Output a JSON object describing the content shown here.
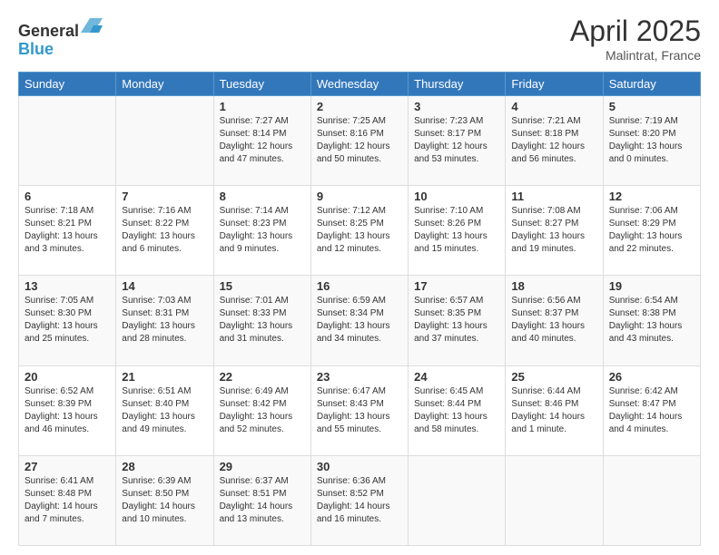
{
  "header": {
    "logo": {
      "line1": "General",
      "line2": "Blue"
    },
    "title": "April 2025",
    "location": "Malintrat, France"
  },
  "days_of_week": [
    "Sunday",
    "Monday",
    "Tuesday",
    "Wednesday",
    "Thursday",
    "Friday",
    "Saturday"
  ],
  "weeks": [
    [
      null,
      null,
      {
        "day": 1,
        "sunrise": "7:27 AM",
        "sunset": "8:14 PM",
        "daylight": "12 hours and 47 minutes."
      },
      {
        "day": 2,
        "sunrise": "7:25 AM",
        "sunset": "8:16 PM",
        "daylight": "12 hours and 50 minutes."
      },
      {
        "day": 3,
        "sunrise": "7:23 AM",
        "sunset": "8:17 PM",
        "daylight": "12 hours and 53 minutes."
      },
      {
        "day": 4,
        "sunrise": "7:21 AM",
        "sunset": "8:18 PM",
        "daylight": "12 hours and 56 minutes."
      },
      {
        "day": 5,
        "sunrise": "7:19 AM",
        "sunset": "8:20 PM",
        "daylight": "13 hours and 0 minutes."
      }
    ],
    [
      {
        "day": 6,
        "sunrise": "7:18 AM",
        "sunset": "8:21 PM",
        "daylight": "13 hours and 3 minutes."
      },
      {
        "day": 7,
        "sunrise": "7:16 AM",
        "sunset": "8:22 PM",
        "daylight": "13 hours and 6 minutes."
      },
      {
        "day": 8,
        "sunrise": "7:14 AM",
        "sunset": "8:23 PM",
        "daylight": "13 hours and 9 minutes."
      },
      {
        "day": 9,
        "sunrise": "7:12 AM",
        "sunset": "8:25 PM",
        "daylight": "13 hours and 12 minutes."
      },
      {
        "day": 10,
        "sunrise": "7:10 AM",
        "sunset": "8:26 PM",
        "daylight": "13 hours and 15 minutes."
      },
      {
        "day": 11,
        "sunrise": "7:08 AM",
        "sunset": "8:27 PM",
        "daylight": "13 hours and 19 minutes."
      },
      {
        "day": 12,
        "sunrise": "7:06 AM",
        "sunset": "8:29 PM",
        "daylight": "13 hours and 22 minutes."
      }
    ],
    [
      {
        "day": 13,
        "sunrise": "7:05 AM",
        "sunset": "8:30 PM",
        "daylight": "13 hours and 25 minutes."
      },
      {
        "day": 14,
        "sunrise": "7:03 AM",
        "sunset": "8:31 PM",
        "daylight": "13 hours and 28 minutes."
      },
      {
        "day": 15,
        "sunrise": "7:01 AM",
        "sunset": "8:33 PM",
        "daylight": "13 hours and 31 minutes."
      },
      {
        "day": 16,
        "sunrise": "6:59 AM",
        "sunset": "8:34 PM",
        "daylight": "13 hours and 34 minutes."
      },
      {
        "day": 17,
        "sunrise": "6:57 AM",
        "sunset": "8:35 PM",
        "daylight": "13 hours and 37 minutes."
      },
      {
        "day": 18,
        "sunrise": "6:56 AM",
        "sunset": "8:37 PM",
        "daylight": "13 hours and 40 minutes."
      },
      {
        "day": 19,
        "sunrise": "6:54 AM",
        "sunset": "8:38 PM",
        "daylight": "13 hours and 43 minutes."
      }
    ],
    [
      {
        "day": 20,
        "sunrise": "6:52 AM",
        "sunset": "8:39 PM",
        "daylight": "13 hours and 46 minutes."
      },
      {
        "day": 21,
        "sunrise": "6:51 AM",
        "sunset": "8:40 PM",
        "daylight": "13 hours and 49 minutes."
      },
      {
        "day": 22,
        "sunrise": "6:49 AM",
        "sunset": "8:42 PM",
        "daylight": "13 hours and 52 minutes."
      },
      {
        "day": 23,
        "sunrise": "6:47 AM",
        "sunset": "8:43 PM",
        "daylight": "13 hours and 55 minutes."
      },
      {
        "day": 24,
        "sunrise": "6:45 AM",
        "sunset": "8:44 PM",
        "daylight": "13 hours and 58 minutes."
      },
      {
        "day": 25,
        "sunrise": "6:44 AM",
        "sunset": "8:46 PM",
        "daylight": "14 hours and 1 minute."
      },
      {
        "day": 26,
        "sunrise": "6:42 AM",
        "sunset": "8:47 PM",
        "daylight": "14 hours and 4 minutes."
      }
    ],
    [
      {
        "day": 27,
        "sunrise": "6:41 AM",
        "sunset": "8:48 PM",
        "daylight": "14 hours and 7 minutes."
      },
      {
        "day": 28,
        "sunrise": "6:39 AM",
        "sunset": "8:50 PM",
        "daylight": "14 hours and 10 minutes."
      },
      {
        "day": 29,
        "sunrise": "6:37 AM",
        "sunset": "8:51 PM",
        "daylight": "14 hours and 13 minutes."
      },
      {
        "day": 30,
        "sunrise": "6:36 AM",
        "sunset": "8:52 PM",
        "daylight": "14 hours and 16 minutes."
      },
      null,
      null,
      null
    ]
  ]
}
